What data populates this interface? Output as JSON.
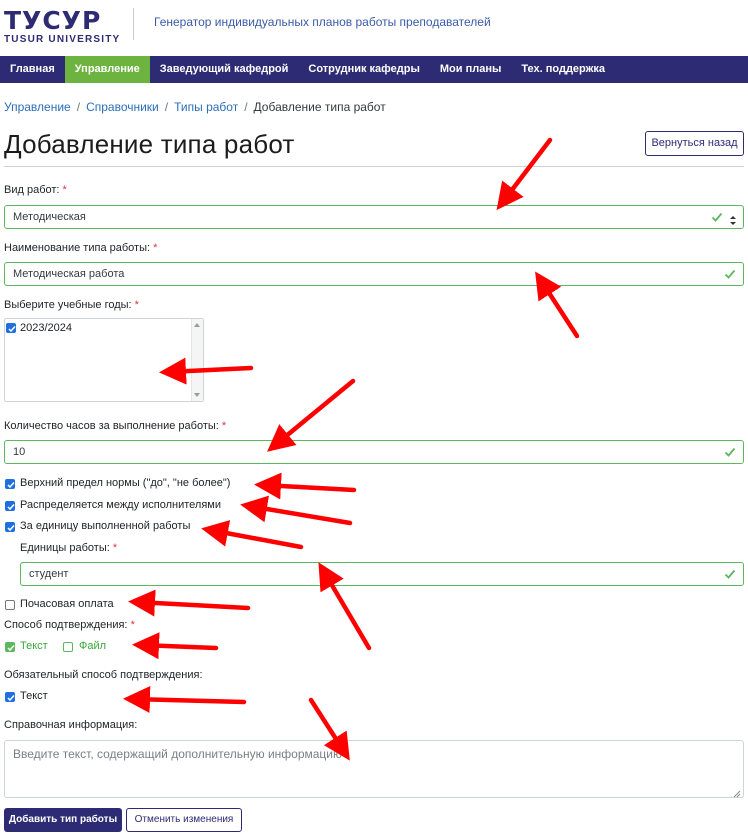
{
  "header": {
    "logo_text": "ТУСУР",
    "logo_sub": "TUSUR UNIVERSITY",
    "title": "Генератор индивидуальных планов работы преподавателей"
  },
  "nav": {
    "items": [
      {
        "label": "Главная",
        "active": false
      },
      {
        "label": "Управление",
        "active": true
      },
      {
        "label": "Заведующий кафедрой",
        "active": false
      },
      {
        "label": "Сотрудник кафедры",
        "active": false
      },
      {
        "label": "Мои планы",
        "active": false
      },
      {
        "label": "Тех. поддержка",
        "active": false
      }
    ]
  },
  "breadcrumb": {
    "items": [
      "Управление",
      "Справочники",
      "Типы работ"
    ],
    "separator": "/",
    "current": "Добавление типа работ"
  },
  "page": {
    "title": "Добавление типа работ",
    "back_button": "Вернуться назад"
  },
  "form": {
    "required_mark": "*",
    "work_kind": {
      "label": "Вид работ:",
      "value": "Методическая"
    },
    "work_type_name": {
      "label": "Наименование типа работы:",
      "value": "Методическая работа"
    },
    "years": {
      "label": "Выберите учебные годы:",
      "options": [
        {
          "label": "2023/2024",
          "checked": true
        }
      ]
    },
    "hours": {
      "label": "Количество часов за выполнение работы:",
      "value": "10"
    },
    "upper_limit": {
      "label": "Верхний предел нормы (\"до\", \"не более\")",
      "checked": true
    },
    "distributed": {
      "label": "Распределяется между исполнителями",
      "checked": true
    },
    "per_unit": {
      "label": "За единицу выполненной работы",
      "checked": true
    },
    "units": {
      "label": "Единицы работы:",
      "value": "студент"
    },
    "hourly_pay": {
      "label": "Почасовая оплата",
      "checked": false
    },
    "confirm_method": {
      "label": "Способ подтверждения:",
      "options": [
        {
          "label": "Текст",
          "checked": true
        },
        {
          "label": "Файл",
          "checked": false
        }
      ]
    },
    "mandatory_confirm": {
      "label": "Обязательный способ подтверждения:",
      "options": [
        {
          "label": "Текст",
          "checked": true
        }
      ]
    },
    "reference_info": {
      "label": "Справочная информация:",
      "placeholder": "Введите текст, содержащий дополнительную информацию"
    },
    "submit_button": "Добавить тип работы",
    "cancel_button": "Отменить изменения"
  },
  "colors": {
    "brand": "#2d2b74",
    "nav_active": "#6cb33f",
    "valid_green": "#5cb85c",
    "annotation_red": "#ff0000"
  }
}
